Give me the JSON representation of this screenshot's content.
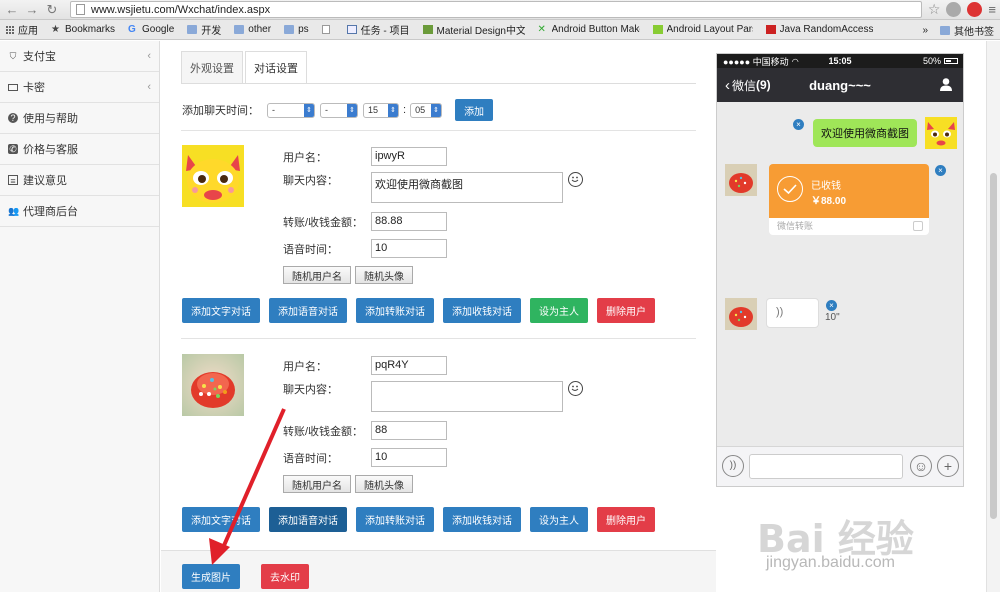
{
  "browser": {
    "url": "www.wsjietu.com/Wxchat/index.aspx",
    "bookmarks": [
      "应用",
      "Bookmarks",
      "Google",
      "开发",
      "other",
      "ps",
      "任务 - 项目",
      "Material Design中文版",
      "Android Button Maker",
      "Android Layout Parse",
      "Java RandomAccess"
    ],
    "bookmarks_more": "»",
    "other_bookmarks": "其他书签"
  },
  "sidebar": {
    "items": [
      {
        "label": "支付宝",
        "icon": "shield-icon",
        "has_arrow": true
      },
      {
        "label": "卡密",
        "icon": "card-icon",
        "has_arrow": true
      },
      {
        "label": "使用与帮助",
        "icon": "help-icon",
        "has_arrow": false
      },
      {
        "label": "价格与客服",
        "icon": "phone-icon",
        "has_arrow": false
      },
      {
        "label": "建议意见",
        "icon": "list-icon",
        "has_arrow": false
      },
      {
        "label": "代理商后台",
        "icon": "users-icon",
        "has_arrow": false
      }
    ],
    "arrow": "‹"
  },
  "tabs": [
    "外观设置",
    "对话设置"
  ],
  "add_time": {
    "label": "添加聊天时间：",
    "select1": "-",
    "select2": "-",
    "select3": "15",
    "colon": ":",
    "select4": "05",
    "button": "添加"
  },
  "users": [
    {
      "name_label": "用户名：",
      "name": "ipwyR",
      "content_label": "聊天内容：",
      "content": "欢迎使用微商截图",
      "amount_label": "转账/收钱金额：",
      "amount": "88.88",
      "voice_label": "语音时间：",
      "voice": "10"
    },
    {
      "name_label": "用户名：",
      "name": "pqR4Y",
      "content_label": "聊天内容：",
      "content": "",
      "amount_label": "转账/收钱金额：",
      "amount": "88",
      "voice_label": "语音时间：",
      "voice": "10"
    }
  ],
  "random_buttons": {
    "name": "随机用户名",
    "avatar": "随机头像"
  },
  "actions": {
    "add_text": "添加文字对话",
    "add_voice": "添加语音对话",
    "add_transfer": "添加转账对话",
    "add_receive": "添加收钱对话",
    "set_owner": "设为主人",
    "delete_user": "删除用户"
  },
  "bottom": {
    "generate": "生成图片",
    "remove_watermark": "去水印"
  },
  "phone": {
    "carrier": "●●●●● 中国移动",
    "time": "15:05",
    "battery": "50%",
    "back_label": "微信",
    "unread": "(9)",
    "chat_title": "duang~~~",
    "welcome_msg": "欢迎使用微商截图",
    "pay_status": "已收钱",
    "pay_amount": "￥88.00",
    "pay_footer": "微信转账",
    "voice_duration": "10\"",
    "remove_mark": "×"
  },
  "watermark": {
    "text": "Bai 经验",
    "url": "jingyan.baidu.com"
  },
  "colors": {
    "primary_blue": "#2f7ec0",
    "dark_blue": "#1d5f95",
    "green": "#2fb460",
    "red": "#e33d48",
    "wechat_green": "#9fe658",
    "wechat_orange": "#f79c34",
    "arrow_red": "#e0202a"
  }
}
